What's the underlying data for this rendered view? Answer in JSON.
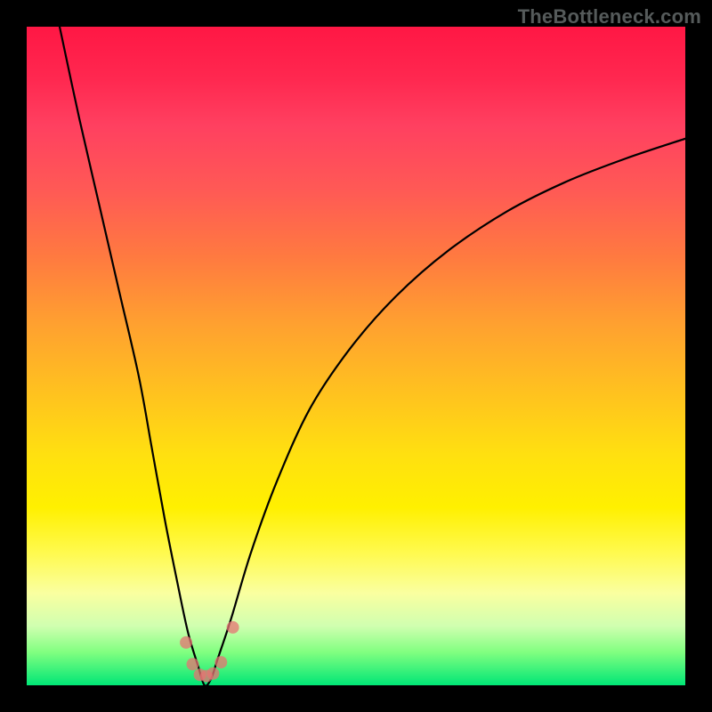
{
  "watermark": "TheBottleneck.com",
  "chart_data": {
    "type": "line",
    "title": "",
    "xlabel": "",
    "ylabel": "",
    "xlim": [
      0,
      100
    ],
    "ylim": [
      0,
      100
    ],
    "series": [
      {
        "name": "bottleneck-curve",
        "x": [
          5,
          8,
          11,
          14,
          17,
          19,
          21,
          23,
          24.5,
          26,
          27,
          28,
          29,
          31,
          34,
          38,
          43,
          49,
          56,
          64,
          73,
          82,
          91,
          100
        ],
        "y": [
          100,
          86,
          73,
          60,
          47,
          36,
          25,
          15,
          8,
          3,
          0,
          1,
          4,
          10,
          20,
          31,
          42,
          51,
          59,
          66,
          72,
          76.5,
          80,
          83
        ]
      }
    ],
    "markers": {
      "name": "highlight-dots",
      "x": [
        24.2,
        25.2,
        26.3,
        27.3,
        28.3,
        29.5,
        31.3
      ],
      "y": [
        6.5,
        3.2,
        1.6,
        1.4,
        1.8,
        3.5,
        8.8
      ]
    },
    "gradient_stops": [
      {
        "pos": 0.0,
        "color": "#ff1744"
      },
      {
        "pos": 0.5,
        "color": "#ffc020"
      },
      {
        "pos": 0.8,
        "color": "#fff000"
      },
      {
        "pos": 1.0,
        "color": "#00e676"
      }
    ]
  }
}
